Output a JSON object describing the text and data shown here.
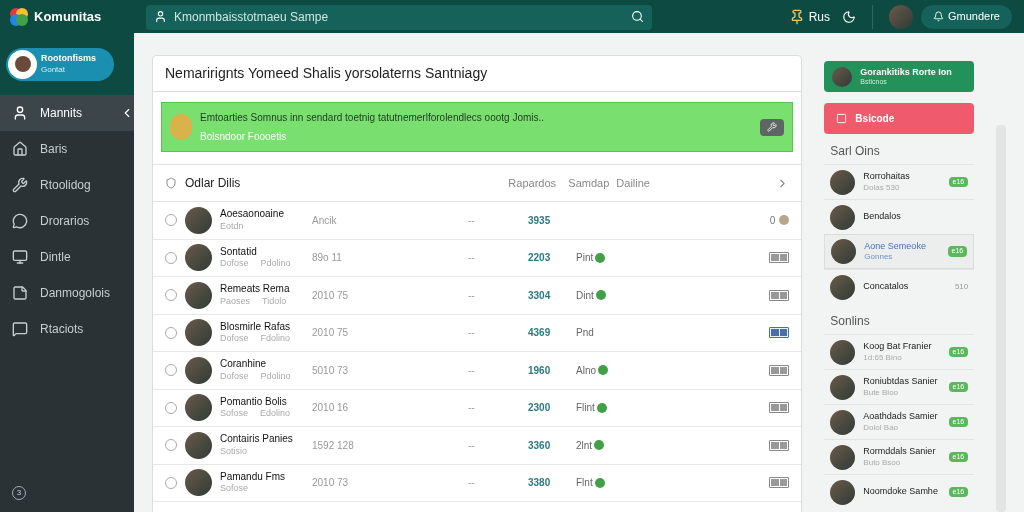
{
  "header": {
    "logo": "Komunitas",
    "search": {
      "placeholder": "Kmonmbaisstotmaeu Sampe"
    },
    "pin_label": "Rus",
    "account_button": "Gmundere"
  },
  "sidebar": {
    "profile": {
      "name": "Rootonfisms",
      "subtitle": "Gontat"
    },
    "items": [
      {
        "label": "Mannits",
        "selected": true
      },
      {
        "label": "Baris",
        "selected": false
      },
      {
        "label": "Rtoolidog",
        "selected": false
      },
      {
        "label": "Drorarios",
        "selected": false
      },
      {
        "label": "Dintle",
        "selected": false
      },
      {
        "label": "Danmogolois",
        "selected": false
      },
      {
        "label": "Rtaciots",
        "selected": false
      }
    ],
    "help": "3"
  },
  "page_title": "Nemarirignts Yomeed Shalis yorsolaterns Santniagy",
  "banner": {
    "text": "Emtoarties Somnus inn sendard toetnig tatutnemerlforolendlecs oootg Jomis..",
    "link": "Bolsndoor Foooetis"
  },
  "table": {
    "title": "Odlar Dilis",
    "columns": [
      "Rapardos",
      "Samdap",
      "Dailine"
    ],
    "rows": [
      {
        "name": "Aoesaonoaine",
        "sub": "Eotdn",
        "column_1": "Ancik",
        "column_2": "--",
        "number": "3935",
        "kind": "count",
        "count": "0",
        "checked": false
      },
      {
        "name": "Sontatid",
        "sub": "Dofose",
        "sub2": "Pdolino",
        "column_1": "89o 11",
        "column_2": "--",
        "number": "2203",
        "status": "Pint",
        "online": true,
        "kind": "action",
        "active": false,
        "checked": false
      },
      {
        "name": "Remeats Rema",
        "sub": "Paoses",
        "sub2": "Tidolo",
        "column_1": "2010 75",
        "column_2": "--",
        "number": "3304",
        "status": "Dint",
        "online": true,
        "kind": "action",
        "active": false,
        "checked": false
      },
      {
        "name": "Blosmirle Rafas",
        "sub": "Dofose",
        "sub2": "Fdolino",
        "column_1": "2010 75",
        "column_2": "--",
        "number": "4369",
        "status": "Pnd",
        "online": false,
        "kind": "action",
        "active": true,
        "checked": false
      },
      {
        "name": "Coranhine",
        "sub": "Dofose",
        "sub2": "Pdolino",
        "column_1": "5010 73",
        "column_2": "--",
        "number": "1960",
        "status": "Alno",
        "online": true,
        "kind": "action",
        "active": false,
        "checked": false
      },
      {
        "name": "Pomantio Bolis",
        "sub": "Sofose",
        "sub2": "Edolino",
        "column_1": "2010 16",
        "column_2": "--",
        "number": "2300",
        "status": "Flint",
        "online": true,
        "kind": "action",
        "active": false,
        "checked": false
      },
      {
        "name": "Contairis Panies",
        "sub": "Sotisio",
        "column_1": "1592 128",
        "column_2": "--",
        "number": "3360",
        "status": "2lnt",
        "online": true,
        "kind": "action",
        "active": false,
        "checked": false
      },
      {
        "name": "Pamandu Fms",
        "sub": "Sofose",
        "column_1": "2010 73",
        "column_2": "--",
        "number": "3380",
        "status": "Flnt",
        "online": true,
        "kind": "action",
        "active": false,
        "checked": false
      }
    ]
  },
  "right_panel": {
    "feature_card": {
      "title": "Gorankitiks Rorte Ion",
      "subtitle": "Bsticnos"
    },
    "alert_button": "Bsicode",
    "sections": [
      {
        "title": "Sarl Oins",
        "items": [
          {
            "name": "Rorrohaitas",
            "sub": "Dolas 530",
            "badge": "e16",
            "selected": false
          },
          {
            "name": "Bendalos",
            "selected": false
          },
          {
            "name": "Aone Semeoke",
            "sub": "Gonnes",
            "badge": "e16",
            "selected": true
          },
          {
            "name": "Concatalos",
            "count": "510",
            "selected": false
          }
        ]
      },
      {
        "title": "Sonlins",
        "items": [
          {
            "name": "Koog Bat Franier",
            "sub": "1d:65 Bino",
            "badge": "e16",
            "selected": false
          },
          {
            "name": "Roniubtdas Sanier",
            "sub": "Bute Bloo",
            "badge": "e16",
            "selected": false
          },
          {
            "name": "Aoathdads Samier",
            "sub": "Dolol Bao",
            "badge": "e16",
            "selected": false
          },
          {
            "name": "Rormddals Sanier",
            "sub": "Buto Bsoo",
            "badge": "e16",
            "selected": false
          },
          {
            "name": "Noomdoke Samhe",
            "badge": "e16",
            "selected": false
          }
        ]
      }
    ]
  }
}
